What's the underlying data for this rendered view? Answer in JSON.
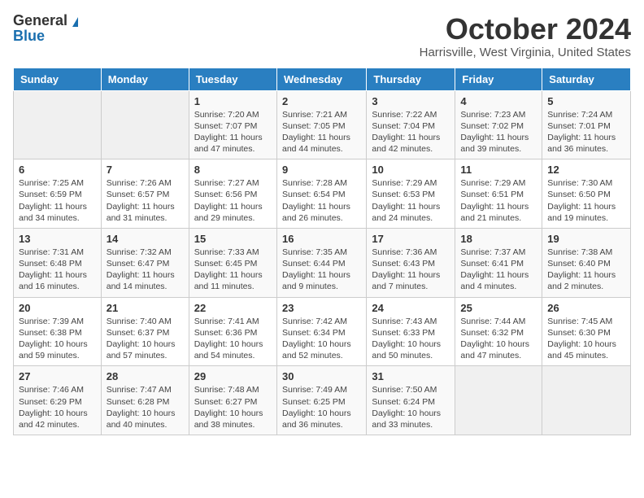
{
  "logo": {
    "general": "General",
    "blue": "Blue"
  },
  "title": "October 2024",
  "location": "Harrisville, West Virginia, United States",
  "days_of_week": [
    "Sunday",
    "Monday",
    "Tuesday",
    "Wednesday",
    "Thursday",
    "Friday",
    "Saturday"
  ],
  "weeks": [
    [
      null,
      null,
      {
        "day": "1",
        "sunrise": "Sunrise: 7:20 AM",
        "sunset": "Sunset: 7:07 PM",
        "daylight": "Daylight: 11 hours and 47 minutes."
      },
      {
        "day": "2",
        "sunrise": "Sunrise: 7:21 AM",
        "sunset": "Sunset: 7:05 PM",
        "daylight": "Daylight: 11 hours and 44 minutes."
      },
      {
        "day": "3",
        "sunrise": "Sunrise: 7:22 AM",
        "sunset": "Sunset: 7:04 PM",
        "daylight": "Daylight: 11 hours and 42 minutes."
      },
      {
        "day": "4",
        "sunrise": "Sunrise: 7:23 AM",
        "sunset": "Sunset: 7:02 PM",
        "daylight": "Daylight: 11 hours and 39 minutes."
      },
      {
        "day": "5",
        "sunrise": "Sunrise: 7:24 AM",
        "sunset": "Sunset: 7:01 PM",
        "daylight": "Daylight: 11 hours and 36 minutes."
      }
    ],
    [
      {
        "day": "6",
        "sunrise": "Sunrise: 7:25 AM",
        "sunset": "Sunset: 6:59 PM",
        "daylight": "Daylight: 11 hours and 34 minutes."
      },
      {
        "day": "7",
        "sunrise": "Sunrise: 7:26 AM",
        "sunset": "Sunset: 6:57 PM",
        "daylight": "Daylight: 11 hours and 31 minutes."
      },
      {
        "day": "8",
        "sunrise": "Sunrise: 7:27 AM",
        "sunset": "Sunset: 6:56 PM",
        "daylight": "Daylight: 11 hours and 29 minutes."
      },
      {
        "day": "9",
        "sunrise": "Sunrise: 7:28 AM",
        "sunset": "Sunset: 6:54 PM",
        "daylight": "Daylight: 11 hours and 26 minutes."
      },
      {
        "day": "10",
        "sunrise": "Sunrise: 7:29 AM",
        "sunset": "Sunset: 6:53 PM",
        "daylight": "Daylight: 11 hours and 24 minutes."
      },
      {
        "day": "11",
        "sunrise": "Sunrise: 7:29 AM",
        "sunset": "Sunset: 6:51 PM",
        "daylight": "Daylight: 11 hours and 21 minutes."
      },
      {
        "day": "12",
        "sunrise": "Sunrise: 7:30 AM",
        "sunset": "Sunset: 6:50 PM",
        "daylight": "Daylight: 11 hours and 19 minutes."
      }
    ],
    [
      {
        "day": "13",
        "sunrise": "Sunrise: 7:31 AM",
        "sunset": "Sunset: 6:48 PM",
        "daylight": "Daylight: 11 hours and 16 minutes."
      },
      {
        "day": "14",
        "sunrise": "Sunrise: 7:32 AM",
        "sunset": "Sunset: 6:47 PM",
        "daylight": "Daylight: 11 hours and 14 minutes."
      },
      {
        "day": "15",
        "sunrise": "Sunrise: 7:33 AM",
        "sunset": "Sunset: 6:45 PM",
        "daylight": "Daylight: 11 hours and 11 minutes."
      },
      {
        "day": "16",
        "sunrise": "Sunrise: 7:35 AM",
        "sunset": "Sunset: 6:44 PM",
        "daylight": "Daylight: 11 hours and 9 minutes."
      },
      {
        "day": "17",
        "sunrise": "Sunrise: 7:36 AM",
        "sunset": "Sunset: 6:43 PM",
        "daylight": "Daylight: 11 hours and 7 minutes."
      },
      {
        "day": "18",
        "sunrise": "Sunrise: 7:37 AM",
        "sunset": "Sunset: 6:41 PM",
        "daylight": "Daylight: 11 hours and 4 minutes."
      },
      {
        "day": "19",
        "sunrise": "Sunrise: 7:38 AM",
        "sunset": "Sunset: 6:40 PM",
        "daylight": "Daylight: 11 hours and 2 minutes."
      }
    ],
    [
      {
        "day": "20",
        "sunrise": "Sunrise: 7:39 AM",
        "sunset": "Sunset: 6:38 PM",
        "daylight": "Daylight: 10 hours and 59 minutes."
      },
      {
        "day": "21",
        "sunrise": "Sunrise: 7:40 AM",
        "sunset": "Sunset: 6:37 PM",
        "daylight": "Daylight: 10 hours and 57 minutes."
      },
      {
        "day": "22",
        "sunrise": "Sunrise: 7:41 AM",
        "sunset": "Sunset: 6:36 PM",
        "daylight": "Daylight: 10 hours and 54 minutes."
      },
      {
        "day": "23",
        "sunrise": "Sunrise: 7:42 AM",
        "sunset": "Sunset: 6:34 PM",
        "daylight": "Daylight: 10 hours and 52 minutes."
      },
      {
        "day": "24",
        "sunrise": "Sunrise: 7:43 AM",
        "sunset": "Sunset: 6:33 PM",
        "daylight": "Daylight: 10 hours and 50 minutes."
      },
      {
        "day": "25",
        "sunrise": "Sunrise: 7:44 AM",
        "sunset": "Sunset: 6:32 PM",
        "daylight": "Daylight: 10 hours and 47 minutes."
      },
      {
        "day": "26",
        "sunrise": "Sunrise: 7:45 AM",
        "sunset": "Sunset: 6:30 PM",
        "daylight": "Daylight: 10 hours and 45 minutes."
      }
    ],
    [
      {
        "day": "27",
        "sunrise": "Sunrise: 7:46 AM",
        "sunset": "Sunset: 6:29 PM",
        "daylight": "Daylight: 10 hours and 42 minutes."
      },
      {
        "day": "28",
        "sunrise": "Sunrise: 7:47 AM",
        "sunset": "Sunset: 6:28 PM",
        "daylight": "Daylight: 10 hours and 40 minutes."
      },
      {
        "day": "29",
        "sunrise": "Sunrise: 7:48 AM",
        "sunset": "Sunset: 6:27 PM",
        "daylight": "Daylight: 10 hours and 38 minutes."
      },
      {
        "day": "30",
        "sunrise": "Sunrise: 7:49 AM",
        "sunset": "Sunset: 6:25 PM",
        "daylight": "Daylight: 10 hours and 36 minutes."
      },
      {
        "day": "31",
        "sunrise": "Sunrise: 7:50 AM",
        "sunset": "Sunset: 6:24 PM",
        "daylight": "Daylight: 10 hours and 33 minutes."
      },
      null,
      null
    ]
  ]
}
